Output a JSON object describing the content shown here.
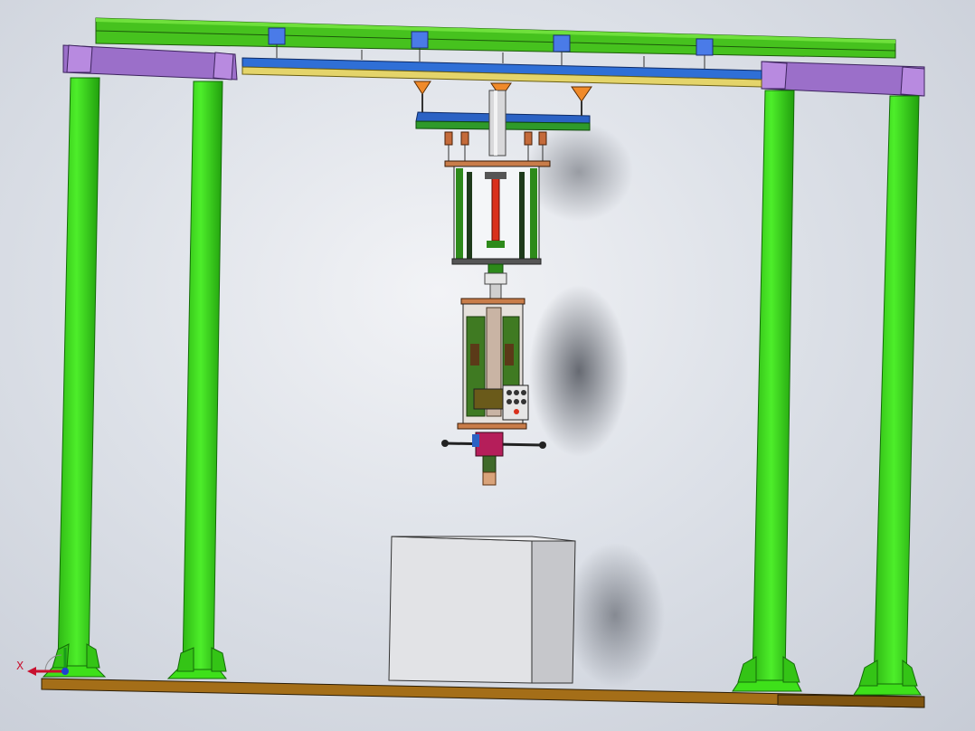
{
  "viewport": {
    "background": [
      "#f2f3f6",
      "#c7ccd6"
    ]
  },
  "model": {
    "colors": {
      "column": "#3ee01a",
      "column_dark": "#1f9a0c",
      "top_beam": "#46c21e",
      "end_beam": "#9b6fc9",
      "crane_rail_blue": "#2f6fd6",
      "crane_rail_yellow": "#e4d46a",
      "trolley_blue": "#2b62c4",
      "cone_orange": "#f08a2a",
      "base_plate": "#a46e18",
      "block": "#dfe0e3",
      "frame_green": "#2d8a1a",
      "rod_red": "#d9301b",
      "control_panel": "#e6e6e6",
      "connector_magenta": "#b51e5a"
    },
    "objects": [
      "gantry-frame",
      "column",
      "overhead-beam",
      "end-beam",
      "crane-rail",
      "trolley",
      "hoist-cylinder",
      "tool-head",
      "control-panel",
      "work-block",
      "base-plate"
    ]
  },
  "triad": {
    "x_axis_label": "X",
    "x_color": "#c8102e",
    "y_color": "#1a9a1a",
    "z_color": "#1f3fd0"
  }
}
